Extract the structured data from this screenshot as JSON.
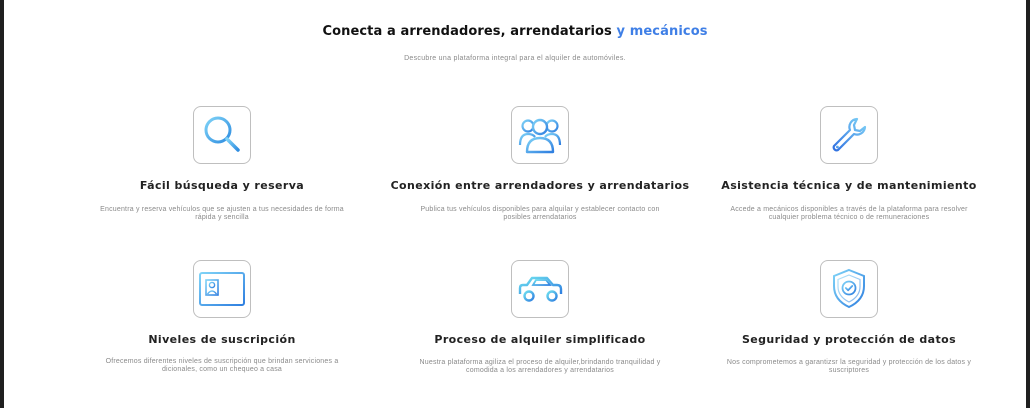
{
  "header": {
    "title_main": "Conecta a arrendadores, arrendatarios",
    "title_accent": "y mecánicos",
    "subtitle": "Descubre una plataforma integral para el alquiler de automóviles.",
    "accent_color": "#3f7fe6"
  },
  "features": [
    {
      "icon": "magnifier-icon",
      "title": "Fácil búsqueda y reserva",
      "description": "Encuentra y reserva vehículos que se ajusten a tus necesidades de forma rápida y sencilla"
    },
    {
      "icon": "users-icon",
      "title": "Conexión entre arrendadores y arrendatarios",
      "description": "Publica tus vehículos disponibles para alquilar y establecer contacto con posibles arrendatarios"
    },
    {
      "icon": "wrench-icon",
      "title": "Asistencia técnica y de mantenimiento",
      "description": "Accede a mecánicos disponibles a través de la plataforma para resolver cualquier problema técnico o de remuneraciones"
    },
    {
      "icon": "id-card-icon",
      "title": "Niveles de suscripción",
      "description": "Ofrecemos diferentes niveles de suscripción que brindan serviciones a dicionales, como un chequeo a casa"
    },
    {
      "icon": "car-icon",
      "title": "Proceso de alquiler simplificado",
      "description": "Nuestra plataforma agiliza el proceso de alquiler,brindando tranquilidad y comodida a los arrendadores y arrendatarios"
    },
    {
      "icon": "shield-check-icon",
      "title": "Seguridad y protección de datos",
      "description": "Nos comprometemos a garantizsr la seguridad y protección de los datos y suscriptores"
    }
  ]
}
